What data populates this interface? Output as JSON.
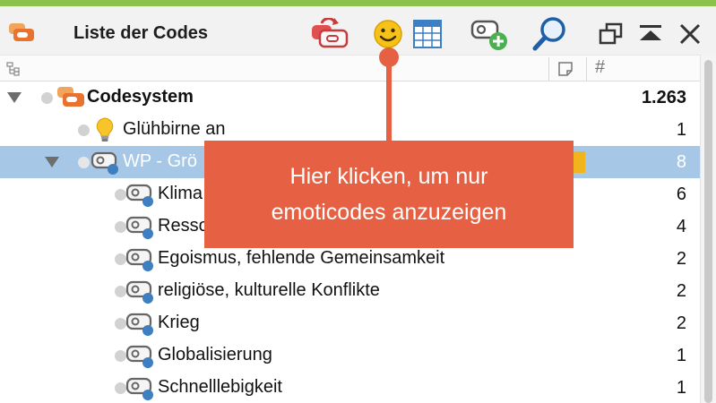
{
  "window": {
    "title": "Liste der Codes"
  },
  "icons": {
    "app": "code-stack-icon",
    "toolbar": [
      "code-link-icon",
      "emoticode-smiley-icon",
      "table-icon",
      "new-code-icon",
      "search-icon"
    ],
    "window": [
      "undock-icon",
      "collapse-icon",
      "close-icon"
    ],
    "colheader": [
      "tree-structure-icon",
      "memo-icon",
      "hash-icon"
    ]
  },
  "colors": {
    "accent_bar": "#8bc34a",
    "selection": "#a6c8e6",
    "callout": "#e66143",
    "code_badge": "#e8872e",
    "color_tag": "#f2b41c"
  },
  "colheader": {
    "hash": "#"
  },
  "tree": {
    "rows": [
      {
        "label": "Codesystem",
        "count": "1.263"
      },
      {
        "label": "Glühbirne an",
        "count": "1"
      },
      {
        "label": "WP - Grö",
        "count": "8"
      },
      {
        "label": "Klima",
        "count": "6"
      },
      {
        "label": "Resso",
        "count": "4"
      },
      {
        "label": "Egoismus, fehlende Gemeinsamkeit",
        "count": "2"
      },
      {
        "label": "religiöse, kulturelle Konflikte",
        "count": "2"
      },
      {
        "label": "Krieg",
        "count": "2"
      },
      {
        "label": "Globalisierung",
        "count": "1"
      },
      {
        "label": "Schnelllebigkeit",
        "count": "1"
      }
    ]
  },
  "callout": {
    "line1": "Hier klicken, um nur",
    "line2": "emoticodes anzuzeigen"
  }
}
